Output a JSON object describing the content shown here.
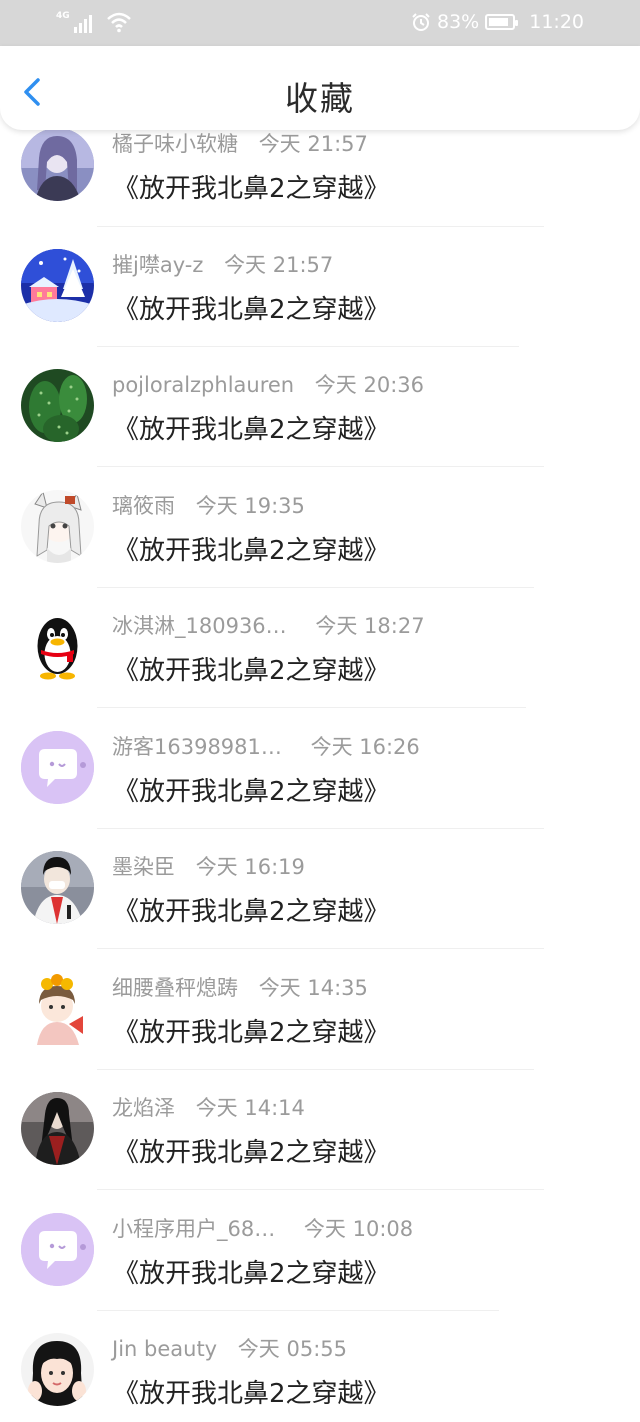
{
  "status_bar": {
    "network": "4G",
    "battery": "83%",
    "time": "11:20"
  },
  "header": {
    "title": "收藏"
  },
  "favorites": [
    {
      "user": "橘子味小软糖",
      "time": "今天 21:57",
      "title": "《放开我北鼻2之穿越》",
      "avatar": "girl-purple-avatar"
    },
    {
      "user": "摧j噤ay-z",
      "time": "今天 21:57",
      "title": "《放开我北鼻2之穿越》",
      "avatar": "snow-night-avatar"
    },
    {
      "user": "pojloralzphlauren",
      "time": "今天 20:36",
      "title": "《放开我北鼻2之穿越》",
      "avatar": "cactus-avatar"
    },
    {
      "user": "璃筱雨",
      "time": "今天 19:35",
      "title": "《放开我北鼻2之穿越》",
      "avatar": "anime-girl-avatar"
    },
    {
      "user": "冰淇淋_180936…",
      "time": "今天 18:27",
      "title": "《放开我北鼻2之穿越》",
      "avatar": "penguin-avatar"
    },
    {
      "user": "游客16398981…",
      "time": "今天 16:26",
      "title": "《放开我北鼻2之穿越》",
      "avatar": "default-purple-avatar"
    },
    {
      "user": "墨染臣",
      "time": "今天 16:19",
      "title": "《放开我北鼻2之穿越》",
      "avatar": "masked-boy-avatar"
    },
    {
      "user": "细腰叠秤熄踌",
      "time": "今天 14:35",
      "title": "《放开我北鼻2之穿越》",
      "avatar": "flower-girl-avatar"
    },
    {
      "user": "龙焰泽",
      "time": "今天 14:14",
      "title": "《放开我北鼻2之穿越》",
      "avatar": "dark-warrior-avatar"
    },
    {
      "user": "小程序用户_68…",
      "time": "今天 10:08",
      "title": "《放开我北鼻2之穿越》",
      "avatar": "default-purple-avatar"
    },
    {
      "user": "Jin beauty",
      "time": "今天 05:55",
      "title": "《放开我北鼻2之穿越》",
      "avatar": "girl-photo-avatar"
    }
  ],
  "colors": {
    "accent": "#2f8ff0",
    "status_bar_bg": "#d7d7d7",
    "meta_text": "#9b9b9b",
    "title_text": "#222222",
    "default_avatar": "#d9c3f5"
  }
}
